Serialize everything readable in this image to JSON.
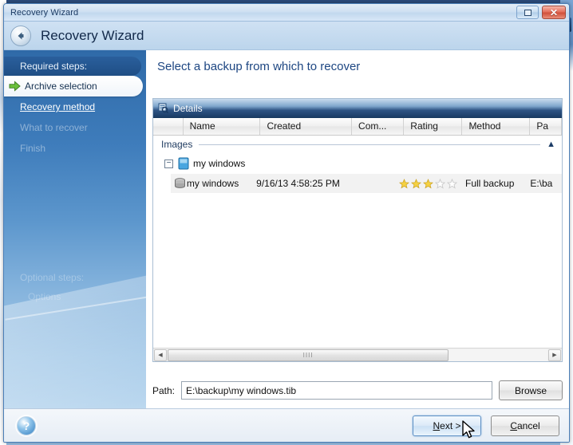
{
  "window": {
    "titlebar_text": "Recovery Wizard",
    "restore_tooltip": "Restore",
    "close_tooltip": "Close",
    "header_title": "Recovery Wizard",
    "back_icon": "back-arrow-icon"
  },
  "sidebar": {
    "required_heading": "Required steps:",
    "steps": [
      {
        "label": "Archive selection",
        "state": "active",
        "icon": "green-arrow-icon"
      },
      {
        "label": "Recovery method",
        "state": "link"
      },
      {
        "label": "What to recover",
        "state": "disabled"
      },
      {
        "label": "Finish",
        "state": "disabled"
      }
    ],
    "optional_heading": "Optional steps:",
    "optional_items": [
      {
        "label": "Options"
      }
    ]
  },
  "main": {
    "page_title": "Select a backup from which to recover",
    "details_panel": {
      "header_label": "Details",
      "header_icon": "details-magnifier-icon",
      "columns": [
        {
          "label": "",
          "width": 38
        },
        {
          "label": "Name",
          "width": 98
        },
        {
          "label": "Created",
          "width": 116
        },
        {
          "label": "Com...",
          "width": 66
        },
        {
          "label": "Rating",
          "width": 74
        },
        {
          "label": "Method",
          "width": 86
        },
        {
          "label": "Pa",
          "width": 40
        }
      ],
      "group": {
        "label": "Images",
        "collapse_icon": "chevron-up-icon",
        "expanded": true
      },
      "tree_node": {
        "label": "my windows",
        "expander": "minus-icon",
        "icon": "archive-icon"
      },
      "rows": [
        {
          "name": "my windows",
          "created": "9/16/13 4:58:25 PM",
          "compression": "",
          "rating_filled": 3,
          "rating_total": 5,
          "method": "Full backup",
          "path": "E:\\ba",
          "icon": "disk-stack-icon",
          "selected": true
        }
      ],
      "hscroll": {
        "left_icon": "triangle-left-icon",
        "right_icon": "triangle-right-icon",
        "thumb_grip": "IIII",
        "thumb_percent": 74
      }
    },
    "path_label": "Path:",
    "path_value": "E:\\backup\\my windows.tib",
    "path_placeholder": "",
    "browse_label": "Browse"
  },
  "footer": {
    "help_icon": "help-question-icon",
    "next_label": "Next >",
    "next_accel": "N",
    "cancel_label": "Cancel",
    "cancel_accel": "C"
  },
  "colors": {
    "accent_blue": "#1d4682",
    "sidebar_top": "#2f6aa8",
    "sidebar_bottom": "#bcd8ef",
    "panel_header_dark": "#1b3c65",
    "star_gold": "#f0c419",
    "close_red": "#d0513c"
  }
}
